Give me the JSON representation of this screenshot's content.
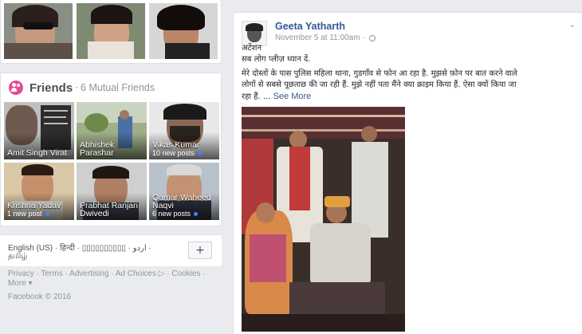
{
  "friends": {
    "title": "Friends",
    "separator": "·",
    "mutual": "6 Mutual Friends",
    "items": [
      {
        "name": "Amit Singh Virat",
        "sub": ""
      },
      {
        "name": "Abhishek",
        "name2": "Parashar",
        "sub": ""
      },
      {
        "name": "Vikas Kumar",
        "sub": "10 new posts"
      },
      {
        "name": "Krishna Yadav",
        "sub": "1 new post"
      },
      {
        "name": "Prabhat Ranjan",
        "name2": "Dwivedi",
        "sub": ""
      },
      {
        "name": "Qamar Waheed",
        "name2": "Naqvi",
        "sub": "6 new posts"
      }
    ]
  },
  "languages": {
    "line1": "English (US) · हिन्दी · ▯▯▯▯▯▯▯▯▯▯ · اردو ·",
    "line2": "தமிழ்",
    "add_label": "+"
  },
  "footer": {
    "line1": "Privacy · Terms · Advertising · Ad Choices ▷ · Cookies ·",
    "line2": "More ▾",
    "copyright": "Facebook © 2016"
  },
  "post": {
    "author": "Geeta Yatharth",
    "timestamp": "November 5 at 11:00am ·",
    "line1": "अटेंशन",
    "line2": "सब लोग प्लीज़ ध्यान दें.",
    "line3": "मेरे दोस्तों के पास पुलिस महिला थाना, गुडगाँव से फोन आ रहा है. मुझसे फ़ोन पर बात करने वाले",
    "line4": "लोगों से सबसे पूछताछ की जा रही हैं. मुझे नहीं पता मैंने क्या क्राइम किया हैं. ऐसा क्यों किया जा",
    "line5": "रहा हैं. ...",
    "see_more": "See More"
  },
  "icons": {
    "friends": "friends-icon",
    "globe": "globe-icon",
    "chevron": "chevron-down-icon"
  },
  "colors": {
    "link": "#365899",
    "friends_icon": "#e34b96",
    "background": "#e9ebee"
  }
}
